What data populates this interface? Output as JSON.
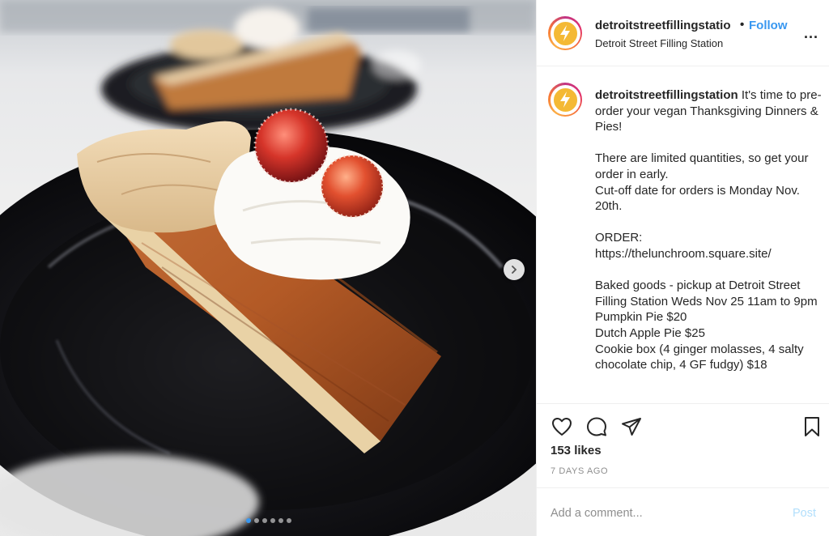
{
  "post": {
    "image_alt": "",
    "carousel": {
      "total": 6,
      "active_index": 0
    }
  },
  "header": {
    "username": "detroitstreetfillingstatio",
    "separator": "•",
    "follow_label": "Follow",
    "subtitle": "Detroit Street Filling Station",
    "more_icon": "ellipsis-icon",
    "more_label": "..."
  },
  "caption": {
    "username": "detroitstreetfillingstation",
    "paragraphs": [
      [
        "It's time to pre-order your vegan Thanksgiving Dinners & Pies!"
      ],
      [
        "There are limited quantities, so get your order in early.",
        "Cut-off date for orders is Monday Nov. 20th."
      ],
      [
        "ORDER:",
        "https://thelunchroom.square.site/"
      ],
      [
        "Baked goods - pickup at Detroit Street Filling Station Weds Nov 25 11am to 9pm",
        "Pumpkin Pie $20",
        "Dutch Apple Pie $25",
        "Cookie box (4 ginger molasses, 4 salty chocolate chip, 4 GF fudgy) $18"
      ]
    ]
  },
  "actions": {
    "like_icon": "heart-icon",
    "comment_icon": "comment-icon",
    "share_icon": "paper-plane-icon",
    "save_icon": "bookmark-icon",
    "likes": "153 likes",
    "timestamp": "7 DAYS AGO"
  },
  "comment": {
    "placeholder": "Add a comment...",
    "post_label": "Post"
  },
  "colors": {
    "link_blue": "#3897f0",
    "post_disabled": "#b2dffc",
    "avatar_yellow": "#f4b934"
  }
}
